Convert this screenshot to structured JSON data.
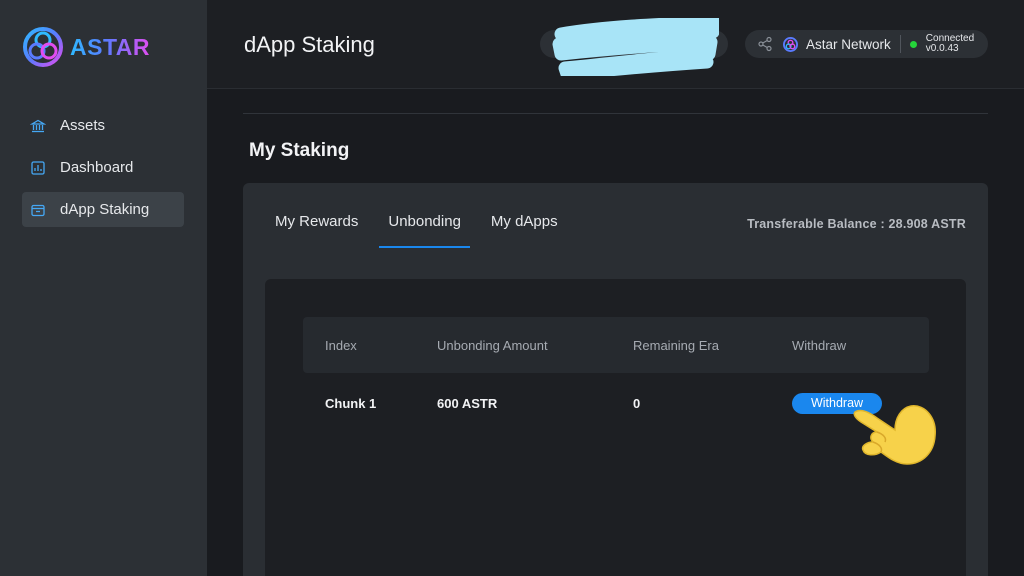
{
  "brand": {
    "name": "ASTAR"
  },
  "sidebar": {
    "items": [
      {
        "label": "Assets",
        "icon": "bank-icon",
        "active": false
      },
      {
        "label": "Dashboard",
        "icon": "chart-icon",
        "active": false
      },
      {
        "label": "dApp Staking",
        "icon": "staking-icon",
        "active": true
      }
    ]
  },
  "header": {
    "title": "dApp Staking",
    "network": {
      "name": "Astar Network",
      "status": "Connected",
      "version": "v0.0.43"
    }
  },
  "main": {
    "section_title": "My Staking",
    "tabs": [
      {
        "label": "My Rewards",
        "active": false
      },
      {
        "label": "Unbonding",
        "active": true
      },
      {
        "label": "My dApps",
        "active": false
      }
    ],
    "balance": "Transferable Balance : 28.908 ASTR",
    "table": {
      "columns": [
        "Index",
        "Unbonding Amount",
        "Remaining Era",
        "Withdraw"
      ],
      "rows": [
        {
          "index": "Chunk 1",
          "amount": "600 ASTR",
          "era": "0",
          "action": "Withdraw"
        }
      ]
    }
  },
  "colors": {
    "accent": "#1a87ee",
    "connected": "#25d43a",
    "redaction": "#a8e4f7",
    "hand": "#f7d24a"
  }
}
